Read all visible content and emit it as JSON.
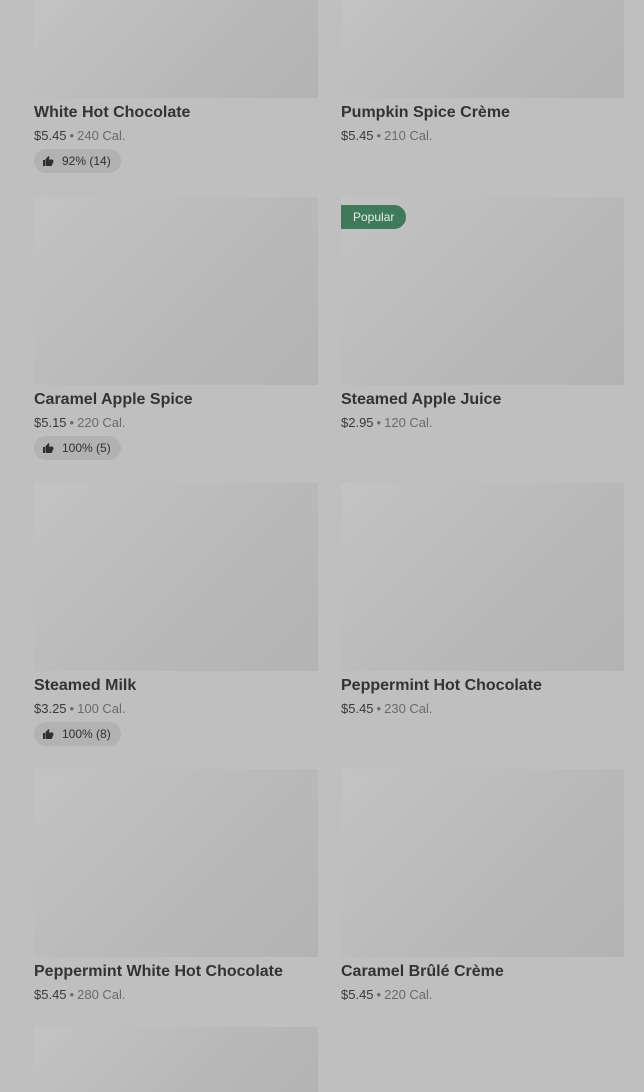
{
  "items": [
    {
      "name": "White Hot Chocolate",
      "price": "$5.45",
      "sep": "•",
      "calories": "240 Cal.",
      "rating": "92% (14)"
    },
    {
      "name": "Pumpkin Spice Crème",
      "price": "$5.45",
      "sep": "•",
      "calories": "210 Cal."
    },
    {
      "name": "Caramel Apple Spice",
      "price": "$5.15",
      "sep": "•",
      "calories": "220 Cal.",
      "rating": "100% (5)"
    },
    {
      "badge": "Popular",
      "name": "Steamed Apple Juice",
      "price": "$2.95",
      "sep": "•",
      "calories": "120 Cal."
    },
    {
      "name": "Steamed Milk",
      "price": "$3.25",
      "sep": "•",
      "calories": "100 Cal.",
      "rating": "100% (8)"
    },
    {
      "name": "Peppermint Hot Chocolate",
      "price": "$5.45",
      "sep": "•",
      "calories": "230 Cal."
    },
    {
      "name": "Peppermint White Hot Chocolate",
      "price": "$5.45",
      "sep": "•",
      "calories": "280 Cal."
    },
    {
      "name": "Caramel Brûlé Crème",
      "price": "$5.45",
      "sep": "•",
      "calories": "220 Cal."
    }
  ],
  "colors": {
    "background": "#bfbfbf",
    "badge": "#3f7a5b",
    "rating_pill": "#b2b2b2"
  },
  "icons": {
    "rating": "thumbs-up-icon"
  }
}
